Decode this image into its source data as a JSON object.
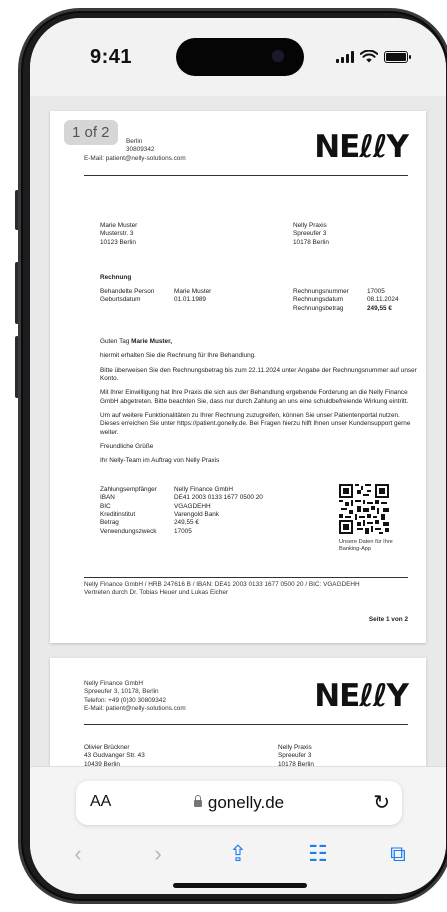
{
  "status_bar": {
    "time": "9:41"
  },
  "page_indicator": "1 of 2",
  "pages": [
    {
      "sender_lines": [
        "Berlin",
        "30809342",
        "E-Mail: patient@nelly-solutions.com"
      ],
      "logo": "NEℓℓY",
      "recipient": [
        "Marie Muster",
        "Musterstr. 3",
        "10123 Berlin"
      ],
      "practice": [
        "Nelly Praxis",
        "Spreeufer 3",
        "10178 Berlin"
      ],
      "section_title": "Rechnung",
      "person": {
        "label_name": "Behandelte Person",
        "value_name": "Marie Muster",
        "label_dob": "Geburtsdatum",
        "value_dob": "01.01.1989"
      },
      "invoice": {
        "label_number": "Rechnungsnummer",
        "value_number": "17005",
        "label_date": "Rechnungsdatum",
        "value_date": "08.11.2024",
        "label_amount": "Rechnungsbetrag",
        "value_amount": "249,55 €"
      },
      "greeting_prefix": "Guten Tag ",
      "greeting_name": "Marie Muster,",
      "paragraphs": [
        "hiermit erhalten Sie die Rechnung für Ihre Behandlung.",
        "Bitte überweisen Sie den Rechnungsbetrag bis zum 22.11.2024 unter Angabe der Rechnungsnummer auf unser Konto.",
        "Mit Ihrer Einwilligung hat Ihre Praxis die sich aus der Behandlung ergebende Forderung an die Nelly Finance GmbH abgetreten. Bitte beachten Sie, dass nur durch Zahlung an uns eine schuldbefreiende Wirkung eintritt.",
        "Um auf weitere Funktionalitäten zu Ihrer Rechnung zuzugreifen, können Sie unser Patientenportal nutzen. Dieses erreichen Sie unter https://patient.gonelly.de. Bei Fragen hierzu hilft Ihnen unser Kundensupport gerne weiter.",
        "Freundliche Grüße",
        "Ihr Nelly-Team im Auftrag von Nelly Praxis"
      ],
      "payment": [
        {
          "label": "Zahlungsempfänger",
          "value": "Nelly Finance GmbH"
        },
        {
          "label": "IBAN",
          "value": "DE41 2003 0133 1677 0500 20"
        },
        {
          "label": "BIC",
          "value": "VGAGDEHH"
        },
        {
          "label": "Kreditinstitut",
          "value": "Varengold Bank"
        },
        {
          "label": "Betrag",
          "value": "249,55 €"
        },
        {
          "label": "Verwendungszweck",
          "value": "17005"
        }
      ],
      "qr_caption": "Unsere Daten für Ihre Banking-App",
      "footer": [
        "Nelly Finance GmbH / HRB 247616 B / IBAN: DE41 2003 0133 1677 0500 20 / BIC: VGAGDEHH",
        "Vertreten durch Dr. Tobias Heuer und Lukas Eicher"
      ],
      "page_number": "Seite 1 von 2"
    },
    {
      "sender_lines": [
        "Nelly Finance GmbH",
        "Spreeufer 3, 10178, Berlin",
        "Telefon: +49 (0)30 30809342",
        "E-Mail: patient@nelly-solutions.com"
      ],
      "logo": "NEℓℓY",
      "recipient": [
        "Olivier Brückner",
        "43 Gudvanger Str. 43",
        "10439 Berlin"
      ],
      "practice": [
        "Nelly Praxis",
        "Spreeufer 3",
        "10178 Berlin"
      ]
    }
  ],
  "browser": {
    "text_size_label": "AA",
    "url": "gonelly.de",
    "reload_icon": "↻",
    "nav": {
      "back": "‹",
      "forward": "›",
      "share": "⇪",
      "bookmarks": "☷",
      "tabs": "⧉"
    }
  }
}
